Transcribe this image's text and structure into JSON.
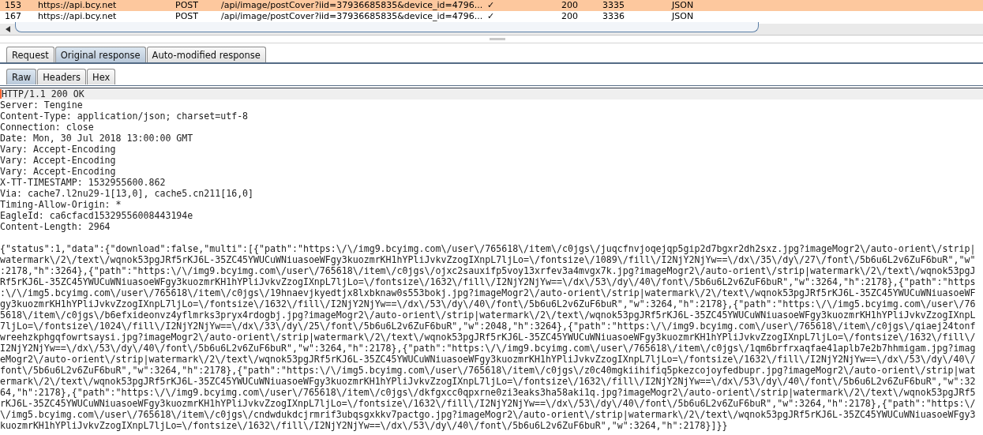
{
  "table": {
    "rows": [
      {
        "cells": [
          "153",
          "https://api.bcy.net",
          "POST",
          "/api/image/postCover?iid=37936685835&device_id=4796...",
          "✓",
          "200",
          "3335",
          "JSON"
        ],
        "selected": true
      },
      {
        "cells": [
          "167",
          "https://api.bcy.net",
          "POST",
          "/api/image/postCover?iid=37936685835&device_id=4796...",
          "✓",
          "200",
          "3336",
          "JSON"
        ],
        "selected": false
      }
    ]
  },
  "tabs": [
    {
      "label": "Request",
      "selected": false
    },
    {
      "label": "Original response",
      "selected": true
    },
    {
      "label": "Auto-modified response",
      "selected": false
    }
  ],
  "subtabs": [
    {
      "label": "Raw",
      "selected": true
    },
    {
      "label": "Headers",
      "selected": false
    },
    {
      "label": "Hex",
      "selected": false
    }
  ],
  "response": {
    "headers": [
      "HTTP/1.1 200 OK",
      "Server: Tengine",
      "Content-Type: application/json; charset=utf-8",
      "Connection: close",
      "Date: Mon, 30 Jul 2018 13:00:00 GMT",
      "Vary: Accept-Encoding",
      "Vary: Accept-Encoding",
      "Vary: Accept-Encoding",
      "X-TT-TIMESTAMP: 1532955600.862",
      "Via: cache7.l2nu29-1[13,0], cache5.cn211[16,0]",
      "Timing-Allow-Origin: *",
      "EagleId: ca6cfacd15329556008443194e",
      "Content-Length: 2964"
    ],
    "body": "{\"status\":1,\"data\":{\"download\":false,\"multi\":[{\"path\":\"https:\\/\\/img9.bcyimg.com\\/user\\/765618\\/item\\/c0jgs\\/juqcfnvjoqejqp5gip2d7bgxr2dh2sxz.jpg?imageMogr2\\/auto-orient\\/strip|watermark\\/2\\/text\\/wqnok53pgJRf5rKJ6L-35ZC45YWUCuWNiuasoeWFgy3kuozmrKH1hYPliJvkvZzogIXnpL7ljLo=\\/fontsize\\/1089\\/fill\\/I2NjY2NjYw==\\/dx\\/35\\/dy\\/27\\/font\\/5b6u6L2v6ZuF6buR\",\"w\":2178,\"h\":3264},{\"path\":\"https:\\/\\/img9.bcyimg.com\\/user\\/765618\\/item\\/c0jgs\\/ojxc2sauxifp5voy13xrfev3a4mvgx7k.jpg?imageMogr2\\/auto-orient\\/strip|watermark\\/2\\/text\\/wqnok53pgJRf5rKJ6L-35ZC45YWUCuWNiuasoeWFgy3kuozmrKH1hYPliJvkvZzogIXnpL7ljLo=\\/fontsize\\/1632\\/fill\\/I2NjY2NjYw==\\/dx\\/53\\/dy\\/40\\/font\\/5b6u6L2v6ZuF6buR\",\"w\":3264,\"h\":2178},{\"path\":\"https:\\/\\/img5.bcyimg.com\\/user\\/765618\\/item\\/c0jgs\\/19hnaevjkyedtjx8lxbknaw0s553bokj.jpg?imageMogr2\\/auto-orient\\/strip|watermark\\/2\\/text\\/wqnok53pgJRf5rKJ6L-35ZC45YWUCuWNiuasoeWFgy3kuozmrKH1hYPliJvkvZzogIXnpL7ljLo=\\/fontsize\\/1632\\/fill\\/I2NjY2NjYw==\\/dx\\/53\\/dy\\/40\\/font\\/5b6u6L2v6ZuF6buR\",\"w\":3264,\"h\":2178},{\"path\":\"https:\\/\\/img5.bcyimg.com\\/user\\/765618\\/item\\/c0jgs\\/b6efxideonvz4yflmrks3pryx4rdogbj.jpg?imageMogr2\\/auto-orient\\/strip|watermark\\/2\\/text\\/wqnok53pgJRf5rKJ6L-35ZC45YWUCuWNiuasoeWFgy3kuozmrKH1hYPliJvkvZzogIXnpL7ljLo=\\/fontsize\\/1024\\/fill\\/I2NjY2NjYw==\\/dx\\/33\\/dy\\/25\\/font\\/5b6u6L2v6ZuF6buR\",\"w\":2048,\"h\":3264},{\"path\":\"https:\\/\\/img9.bcyimg.com\\/user\\/765618\\/item\\/c0jgs\\/qiaej24tonfwreehzkphgqfowrtsaysi.jpg?imageMogr2\\/auto-orient\\/strip|watermark\\/2\\/text\\/wqnok53pgJRf5rKJ6L-35ZC45YWUCuWNiuasoeWFgy3kuozmrKH1hYPliJvkvZzogIXnpL7ljLo=\\/fontsize\\/1632\\/fill\\/I2NjY2NjYw==\\/dx\\/53\\/dy\\/40\\/font\\/5b6u6L2v6ZuF6buR\",\"w\":3264,\"h\":2178},{\"path\":\"https:\\/\\/img9.bcyimg.com\\/user\\/765618\\/item\\/c0jgs\\/1qm6brfrxaqfae41aplb7e2b7hhmigam.jpg?imageMogr2\\/auto-orient\\/strip|watermark\\/2\\/text\\/wqnok53pgJRf5rKJ6L-35ZC45YWUCuWNiuasoeWFgy3kuozmrKH1hYPliJvkvZzogIXnpL7ljLo=\\/fontsize\\/1632\\/fill\\/I2NjY2NjYw==\\/dx\\/53\\/dy\\/40\\/font\\/5b6u6L2v6ZuF6buR\",\"w\":3264,\"h\":2178},{\"path\":\"https:\\/\\/img5.bcyimg.com\\/user\\/765618\\/item\\/c0jgs\\/z0c40mgkiihifiq5pkezcojoyfedbupr.jpg?imageMogr2\\/auto-orient\\/strip|watermark\\/2\\/text\\/wqnok53pgJRf5rKJ6L-35ZC45YWUCuWNiuasoeWFgy3kuozmrKH1hYPliJvkvZzogIXnpL7ljLo=\\/fontsize\\/1632\\/fill\\/I2NjY2NjYw==\\/dx\\/53\\/dy\\/40\\/font\\/5b6u6L2v6ZuF6buR\",\"w\":3264,\"h\":2178},{\"path\":\"https:\\/\\/img9.bcyimg.com\\/user\\/765618\\/item\\/c0jgs\\/dkfgxcc0qpxrne0zi3eaks3ha58aki1q.jpg?imageMogr2\\/auto-orient\\/strip|watermark\\/2\\/text\\/wqnok53pgJRf5rKJ6L-35ZC45YWUCuWNiuasoeWFgy3kuozmrKH1hYPliJvkvZzogIXnpL7ljLo=\\/fontsize\\/1632\\/fill\\/I2NjY2NjYw==\\/dx\\/53\\/dy\\/40\\/font\\/5b6u6L2v6ZuF6buR\",\"w\":3264,\"h\":2178},{\"path\":\"https:\\/\\/img5.bcyimg.com\\/user\\/765618\\/item\\/c0jgs\\/cndwdukdcjrmrif3ubqsgxkkv7pactgo.jpg?imageMogr2\\/auto-orient\\/strip|watermark\\/2\\/text\\/wqnok53pgJRf5rKJ6L-35ZC45YWUCuWNiuasoeWFgy3kuozmrKH1hYPliJvkvZzogIXnpL7ljLo=\\/fontsize\\/1632\\/fill\\/I2NjY2NjYw==\\/dx\\/53\\/dy\\/40\\/font\\/5b6u6L2v6ZuF6buR\",\"w\":3264,\"h\":2178}]}}"
  }
}
